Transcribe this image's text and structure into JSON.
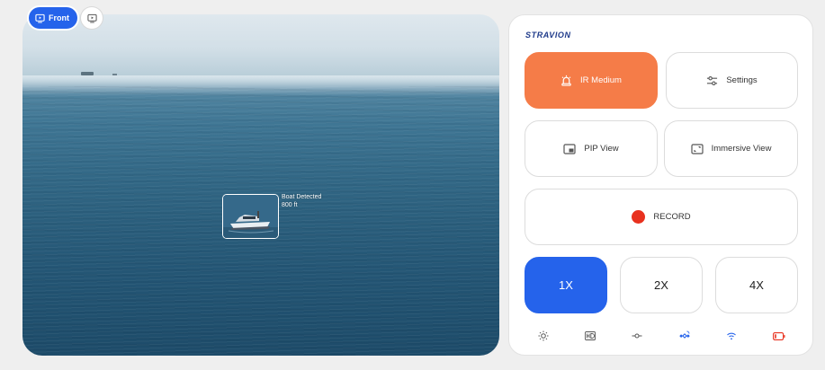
{
  "camera": {
    "tabs": [
      {
        "label": "Front",
        "active": true,
        "icon": "monitor-play-icon"
      },
      {
        "label": "",
        "active": false,
        "icon": "monitor-play-icon"
      }
    ],
    "detection": {
      "label": "Boat Detected",
      "distance": "800 ft"
    }
  },
  "panel": {
    "brand": "STRAVION",
    "ir_button": {
      "label": "IR Medium",
      "icon": "alarm-light-icon",
      "color": "#f57c48"
    },
    "settings_button": {
      "label": "Settings",
      "icon": "sliders-icon"
    },
    "pip_button": {
      "label": "PIP View",
      "icon": "pip-icon"
    },
    "immersive_button": {
      "label": "Immersive View",
      "icon": "expand-icon"
    },
    "record_button": {
      "label": "RECORD",
      "dot_color": "#e8311e"
    },
    "zoom": [
      {
        "label": "1X",
        "active": true
      },
      {
        "label": "2X",
        "active": false
      },
      {
        "label": "4X",
        "active": false
      }
    ],
    "status_icons": [
      {
        "name": "brightness-icon",
        "color": "#555555"
      },
      {
        "name": "hd-icon",
        "color": "#555555"
      },
      {
        "name": "commit-icon",
        "color": "#555555"
      },
      {
        "name": "satellite-icon",
        "color": "#2563eb"
      },
      {
        "name": "wifi-icon",
        "color": "#2563eb"
      },
      {
        "name": "battery-low-icon",
        "color": "#e8311e"
      }
    ],
    "accent": "#2563eb"
  }
}
